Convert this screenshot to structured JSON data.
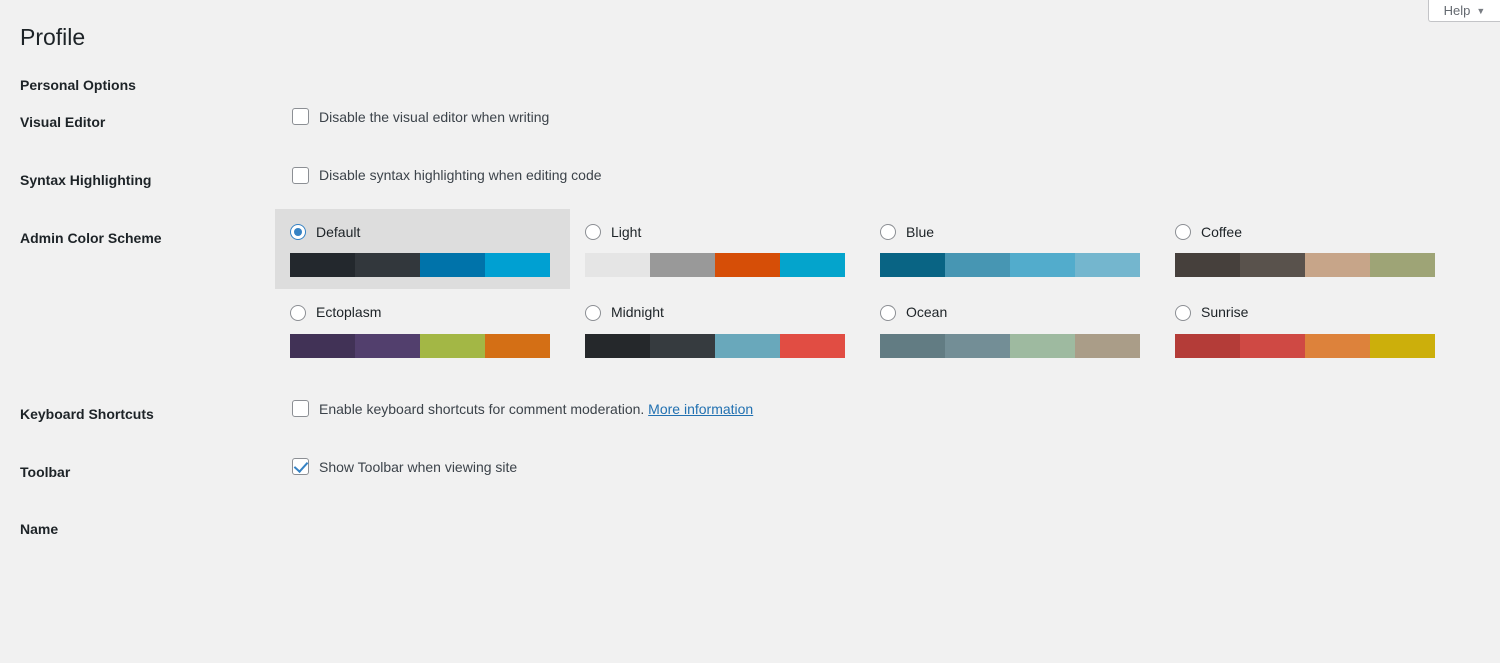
{
  "help": {
    "label": "Help",
    "caret": "▼",
    "icon": "chevron-down-icon"
  },
  "page": {
    "title": "Profile",
    "personal_options_heading": "Personal Options",
    "name_heading": "Name"
  },
  "rows": {
    "visual_editor": {
      "label": "Visual Editor",
      "checkbox_label": "Disable the visual editor when writing",
      "checked": false
    },
    "syntax_highlighting": {
      "label": "Syntax Highlighting",
      "checkbox_label": "Disable syntax highlighting when editing code",
      "checked": false
    },
    "admin_color_scheme": {
      "label": "Admin Color Scheme"
    },
    "keyboard_shortcuts": {
      "label": "Keyboard Shortcuts",
      "checkbox_label": "Enable keyboard shortcuts for comment moderation.",
      "link_label": "More information",
      "checked": false
    },
    "toolbar": {
      "label": "Toolbar",
      "checkbox_label": "Show Toolbar when viewing site",
      "checked": true
    }
  },
  "color_schemes": [
    {
      "name": "Default",
      "selected": true,
      "colors": [
        "#23282d",
        "#32373c",
        "#0073aa",
        "#00a0d2"
      ]
    },
    {
      "name": "Light",
      "selected": false,
      "colors": [
        "#e5e5e5",
        "#999999",
        "#d64e07",
        "#04a4cc"
      ]
    },
    {
      "name": "Blue",
      "selected": false,
      "colors": [
        "#096484",
        "#4796b3",
        "#52accc",
        "#74b6ce"
      ]
    },
    {
      "name": "Coffee",
      "selected": false,
      "colors": [
        "#46403c",
        "#59524c",
        "#c7a589",
        "#9ea476"
      ]
    },
    {
      "name": "Ectoplasm",
      "selected": false,
      "colors": [
        "#413256",
        "#523f6d",
        "#a3b745",
        "#d46f15"
      ]
    },
    {
      "name": "Midnight",
      "selected": false,
      "colors": [
        "#25282b",
        "#363b3f",
        "#69a8bb",
        "#e14d43"
      ]
    },
    {
      "name": "Ocean",
      "selected": false,
      "colors": [
        "#627c83",
        "#738e96",
        "#9ebaa0",
        "#aa9d88"
      ]
    },
    {
      "name": "Sunrise",
      "selected": false,
      "colors": [
        "#b43c38",
        "#cf4944",
        "#dd823b",
        "#ccaf0b"
      ]
    }
  ],
  "theme": {
    "page_background": "#f1f1f1",
    "selected_option_background": "#dddddd",
    "link_color": "#2271b1",
    "accent_color": "#3582c4",
    "heading_color": "#1d2327"
  }
}
